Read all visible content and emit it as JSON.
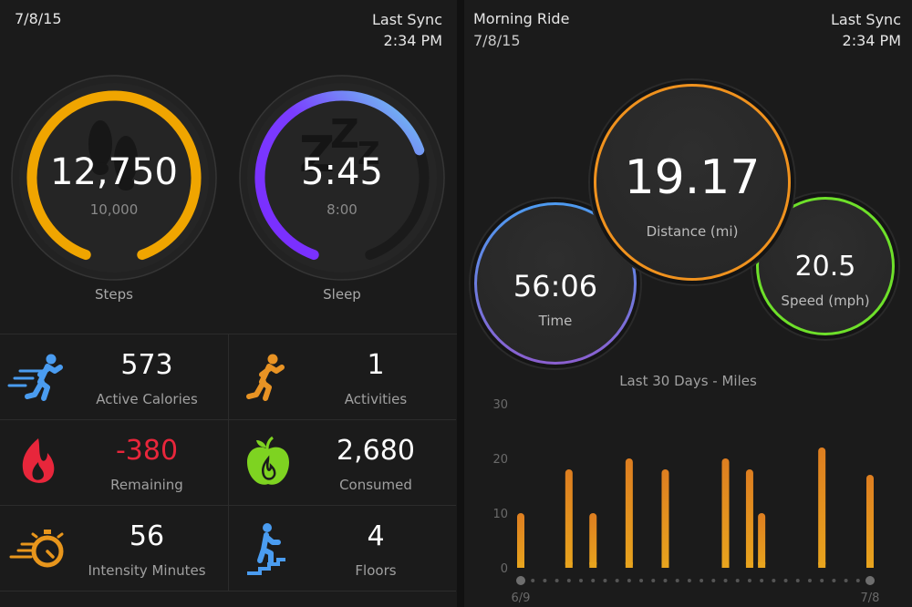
{
  "left": {
    "date": "7/8/15",
    "sync_label": "Last Sync",
    "sync_time": "2:34 PM",
    "steps": {
      "value": "12,750",
      "goal": "10,000",
      "label": "Steps",
      "progress": 1.0,
      "color": "#f0a500"
    },
    "sleep": {
      "value": "5:45",
      "goal": "8:00",
      "label": "Sleep",
      "progress": 0.72,
      "color_start": "#7a2cff",
      "color_end": "#6fd3ee"
    },
    "stats": [
      {
        "icon": "running-fast-icon",
        "value": "573",
        "label": "Active Calories",
        "color": "#4a9cf0",
        "value_color": "#ffffff"
      },
      {
        "icon": "runner-icon",
        "value": "1",
        "label": "Activities",
        "color": "#e89324",
        "value_color": "#ffffff"
      },
      {
        "icon": "flame-icon",
        "value": "-380",
        "label": "Remaining",
        "color": "#e8263b",
        "value_color": "#e8263b"
      },
      {
        "icon": "apple-flame-icon",
        "value": "2,680",
        "label": "Consumed",
        "color": "#7ed321",
        "value_color": "#ffffff"
      },
      {
        "icon": "stopwatch-fast-icon",
        "value": "56",
        "label": "Intensity Minutes",
        "color": "#e8961c",
        "value_color": "#ffffff"
      },
      {
        "icon": "stairs-climber-icon",
        "value": "4",
        "label": "Floors",
        "color": "#4a9cf0",
        "value_color": "#ffffff"
      }
    ]
  },
  "right": {
    "activity_title": "Morning Ride",
    "date": "7/8/15",
    "sync_label": "Last Sync",
    "sync_time": "2:34 PM",
    "distance": {
      "value": "19.17",
      "label": "Distance (mi)",
      "color": "#f0921e"
    },
    "time": {
      "value": "56:06",
      "label": "Time",
      "color_start": "#4d9bf0",
      "color_end": "#8b5fd0"
    },
    "speed": {
      "value": "20.5",
      "label": "Speed (mph)",
      "color": "#6ee02a"
    }
  },
  "chart_data": {
    "type": "bar",
    "title": "Last 30 Days - Miles",
    "xlabel": "",
    "ylabel": "",
    "ylim": [
      0,
      30
    ],
    "yticks": [
      0,
      10,
      20,
      30
    ],
    "x_start_label": "6/9",
    "x_end_label": "7/8",
    "num_days": 30,
    "bar_color_top": "#de7e20",
    "bar_color_bottom": "#e8a41e",
    "bars": [
      {
        "day": 0,
        "value": 10
      },
      {
        "day": 4,
        "value": 18
      },
      {
        "day": 6,
        "value": 10
      },
      {
        "day": 9,
        "value": 20
      },
      {
        "day": 12,
        "value": 18
      },
      {
        "day": 17,
        "value": 20
      },
      {
        "day": 19,
        "value": 18
      },
      {
        "day": 20,
        "value": 10
      },
      {
        "day": 25,
        "value": 22
      },
      {
        "day": 29,
        "value": 17
      }
    ]
  }
}
